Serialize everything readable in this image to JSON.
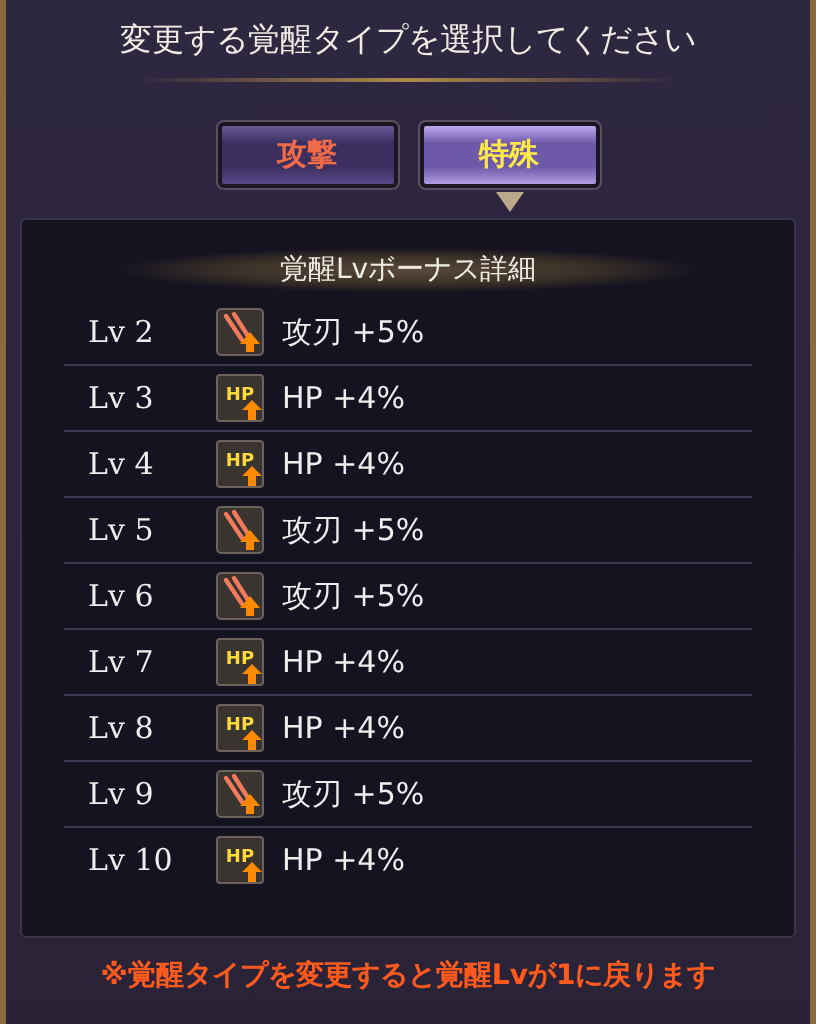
{
  "title": "変更する覚醒タイプを選択してください",
  "tabs": [
    {
      "label": "攻撃",
      "selected": false
    },
    {
      "label": "特殊",
      "selected": true
    }
  ],
  "panel": {
    "heading": "覚醒Lvボーナス詳細",
    "rows": [
      {
        "level": "Lv 2",
        "kind": "blade",
        "bonus": "攻刃 +5%"
      },
      {
        "level": "Lv 3",
        "kind": "hp",
        "icon_text": "HP",
        "bonus": "HP +4%"
      },
      {
        "level": "Lv 4",
        "kind": "hp",
        "icon_text": "HP",
        "bonus": "HP +4%"
      },
      {
        "level": "Lv 5",
        "kind": "blade",
        "bonus": "攻刃 +5%"
      },
      {
        "level": "Lv 6",
        "kind": "blade",
        "bonus": "攻刃 +5%"
      },
      {
        "level": "Lv 7",
        "kind": "hp",
        "icon_text": "HP",
        "bonus": "HP +4%"
      },
      {
        "level": "Lv 8",
        "kind": "hp",
        "icon_text": "HP",
        "bonus": "HP +4%"
      },
      {
        "level": "Lv 9",
        "kind": "blade",
        "bonus": "攻刃 +5%"
      },
      {
        "level": "Lv 10",
        "kind": "hp",
        "icon_text": "HP",
        "bonus": "HP +4%"
      }
    ]
  },
  "note": "※覚醒タイプを変更すると覚醒Lvが1に戻ります"
}
